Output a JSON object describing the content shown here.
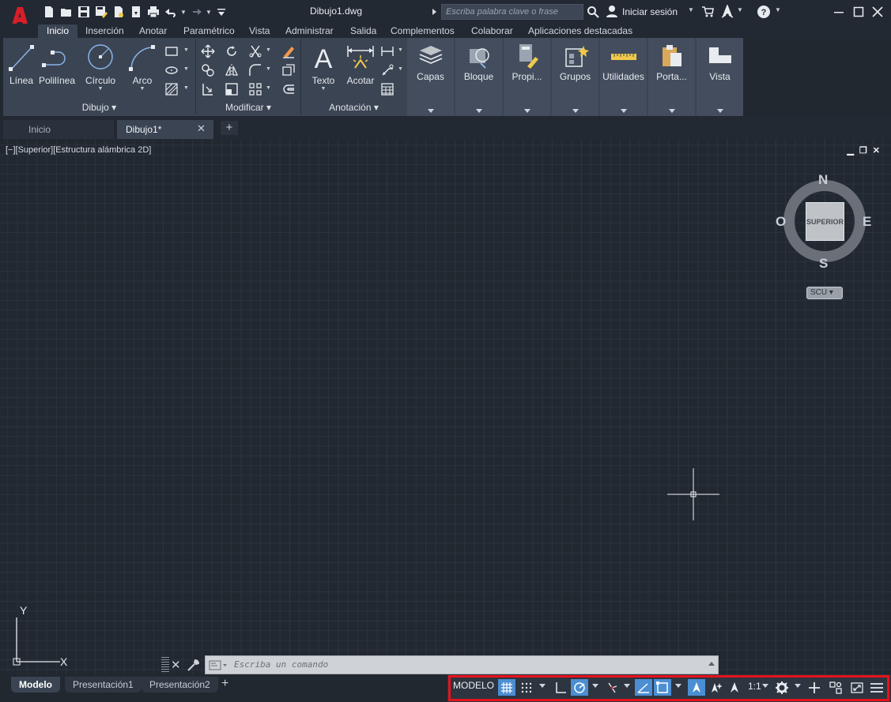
{
  "titlebar": {
    "document_title": "Dibujo1.dwg",
    "search_placeholder": "Escriba palabra clave o frase",
    "signin_label": "Iniciar sesión"
  },
  "ribbon_tabs": [
    "Inicio",
    "Inserción",
    "Anotar",
    "Paramétrico",
    "Vista",
    "Administrar",
    "Salida",
    "Complementos",
    "Colaborar",
    "Aplicaciones destacadas"
  ],
  "ribbon": {
    "dibujo": {
      "label": "Dibujo",
      "tools": [
        "Línea",
        "Polilínea",
        "Círculo",
        "Arco"
      ]
    },
    "modificar": {
      "label": "Modificar"
    },
    "anotacion": {
      "label": "Anotación",
      "tools": [
        "Texto",
        "Acotar"
      ]
    },
    "collapsed": [
      "Capas",
      "Bloque",
      "Propi...",
      "Grupos",
      "Utilidades",
      "Porta...",
      "Vista"
    ]
  },
  "file_tabs": {
    "start": "Inicio",
    "active": "Dibujo1*"
  },
  "viewport": {
    "label": "[−][Superior][Estructura alámbrica 2D]",
    "viewcube": {
      "north": "N",
      "south": "S",
      "east": "E",
      "west": "O",
      "face": "SUPERIOR",
      "ucs": "SCU"
    },
    "ucs_axes": {
      "x": "X",
      "y": "Y"
    }
  },
  "command_line": {
    "placeholder": "Escriba un comando"
  },
  "layout_tabs": [
    "Modelo",
    "Presentación1",
    "Presentación2"
  ],
  "statusbar": {
    "model": "MODELO",
    "scale": "1:1",
    "highlight_color": "#e8121b",
    "active_color": "#4b8ed2"
  }
}
